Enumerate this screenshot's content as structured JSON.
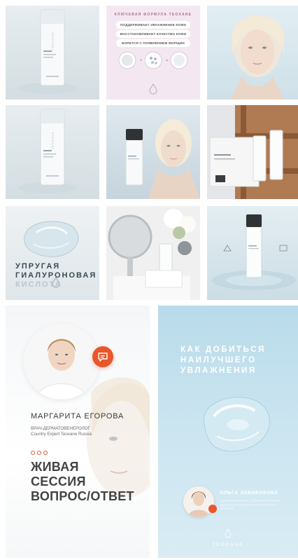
{
  "grid": {
    "tile2": {
      "kicker": "КЛЮЧЕВАЯ ФОРМУЛА TEOXANE",
      "benefits": [
        "ПОДДЕРЖИВАЕТ УВЛАЖНЕНИЕ КОЖИ",
        "ВОССТАНАВЛИВАЕТ КАЧЕСТВО КОЖИ",
        "БОРЕТСЯ С ПОЯВЛЕНИЕМ МОРЩИН"
      ]
    },
    "tile7": {
      "line1": "УПРУГАЯ",
      "line2": "ГИАЛУРОНОВАЯ",
      "line3": "КИСЛОТА"
    },
    "bottle_label": "TEOXANE"
  },
  "story_left": {
    "expert_name": "МАРГАРИТА ЕГОРОВА",
    "role_line1": "ВРАЧ-ДЕРМАТОВЕНЕРОЛОГ",
    "role_line2": "Country Expert Teoxane Russia",
    "title_line1": "ЖИВАЯ",
    "title_line2": "СЕССИЯ",
    "title_line3": "ВОПРОС/ОТВЕТ",
    "accent_color": "#e8562a"
  },
  "story_right": {
    "headline_line1": "КАК ДОБИТЬСЯ",
    "headline_line2": "НАИЛУЧШЕГО",
    "headline_line3": "УВЛАЖНЕНИЯ",
    "expert_name": "ОЛЬГА ЗАБНЕНКОВА",
    "expert_role": "ВРАЧ-КОСМЕТОЛОГ, ДЕРМАТОЛОГ ВРАЧ МЕЖДУНАРОДНЫЙ ТРЕНЕР-ЭКСПЕРТ TEOXANE",
    "brand": "TEOXANE",
    "accent_color": "#e8562a"
  }
}
